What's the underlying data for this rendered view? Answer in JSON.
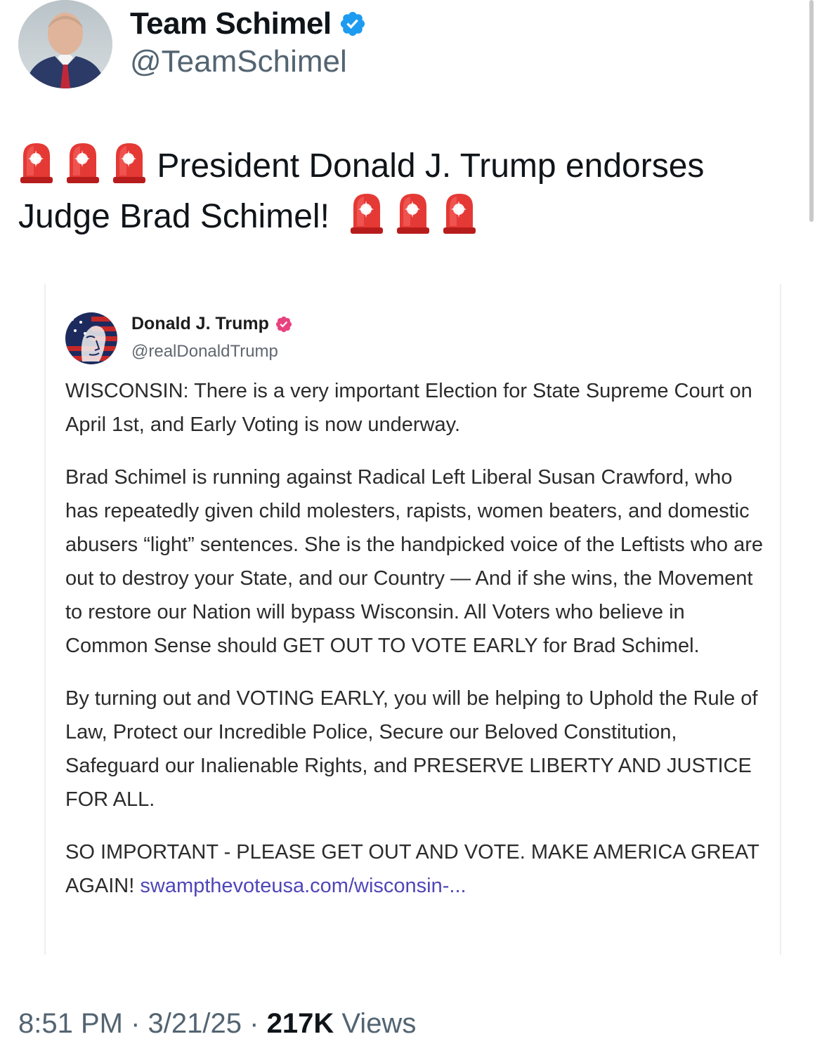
{
  "author": {
    "display_name": "Team Schimel",
    "handle": "@TeamSchimel"
  },
  "tweet": {
    "text_line1": "President Donald J. Trump endorses",
    "text_line2": "Judge Brad Schimel!",
    "emoji": "police-car-light-icon"
  },
  "embedded_post": {
    "display_name": "Donald J. Trump",
    "handle": "@realDonaldTrump",
    "badge_color": "#e8427f",
    "paragraphs": [
      "WISCONSIN: There is a very important Election for State Supreme Court on April 1st, and Early Voting is now underway.",
      "Brad Schimel is running against Radical Left Liberal Susan Crawford, who has repeatedly given child molesters, rapists, women beaters, and domestic abusers “light” sentences. She is the handpicked voice of the Leftists who are out to destroy your State, and our Country — And if she wins, the Movement to restore our Nation will bypass Wisconsin. All Voters who believe in Common Sense should GET OUT TO VOTE EARLY for Brad Schimel.",
      "By turning out and VOTING EARLY, you will be helping to Uphold the Rule of Law, Protect our Incredible Police, Secure our Beloved Constitution, Safeguard our Inalienable Rights, and PRESERVE LIBERTY AND JUSTICE FOR ALL."
    ],
    "last_paragraph_text": "SO IMPORTANT - PLEASE GET OUT AND VOTE. MAKE AMERICA GREAT AGAIN!",
    "link_text": "swampthevoteusa.com/wisconsin-..."
  },
  "meta": {
    "time": "8:51 PM",
    "date": "3/21/25",
    "separator": "·",
    "views_count": "217K",
    "views_label": "Views"
  },
  "colors": {
    "verified_blue": "#1d9bf0",
    "link_purple": "#4f46b8"
  }
}
